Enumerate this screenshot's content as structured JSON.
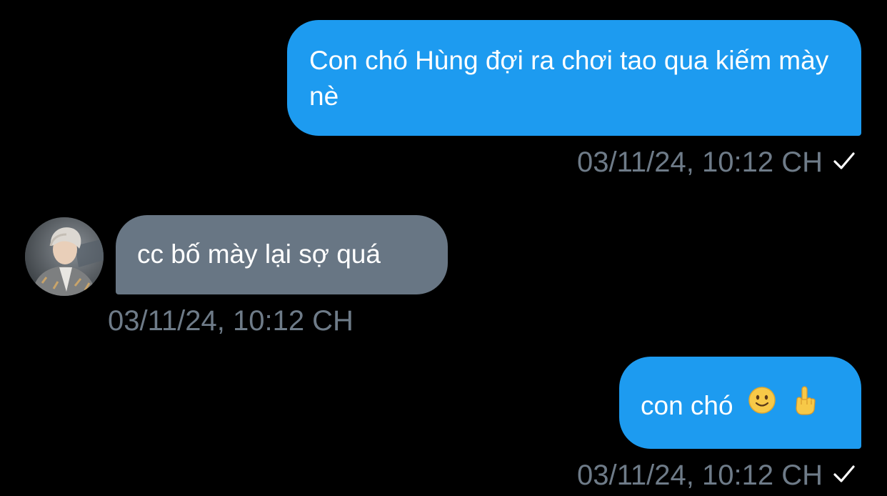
{
  "messages": [
    {
      "direction": "sent",
      "text": "Con chó Hùng đợi ra chơi tao qua kiếm mày nè",
      "timestamp": "03/11/24, 10:12 CH",
      "status_icon": "checkmark-icon"
    },
    {
      "direction": "received",
      "text": "cc bố mày lại sợ quá",
      "timestamp": "03/11/24, 10:12 CH",
      "avatar": "avatar"
    },
    {
      "direction": "sent",
      "text": "con chó",
      "emojis": [
        "slightly-smiling-face-emoji",
        "middle-finger-emoji"
      ],
      "timestamp": "03/11/24, 10:12 CH",
      "status_icon": "checkmark-icon"
    }
  ],
  "colors": {
    "background": "#000000",
    "sent_bubble": "#1d9bf0",
    "received_bubble": "#687684",
    "timestamp": "#6e7b88"
  }
}
